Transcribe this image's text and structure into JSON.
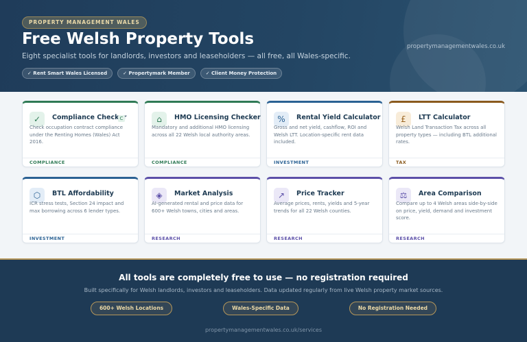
{
  "hero": {
    "kicker": "PROPERTY MANAGEMENT WALES",
    "title": "Free Welsh Property Tools",
    "subtitle": "Eight specialist tools for landlords, investors and leaseholders — all free, all Wales-specific.",
    "site": "propertymanagementwales.co.uk",
    "badges": [
      "✓ Rent Smart Wales Licensed",
      "✓ Propertymark Member",
      "✓ Client Money Protection"
    ]
  },
  "tools": [
    {
      "title": "Compliance Checker",
      "icon": "✓",
      "icon_name": "check-icon",
      "desc": "Check occupation contract compliance under the Renting Homes (Wales) Act 2016.",
      "category": "COMPLIANCE",
      "extra": "C"
    },
    {
      "title": "HMO Licensing Checker",
      "icon": "⌂",
      "icon_name": "house-icon",
      "desc": "Mandatory and additional HMO licensing across all 22 Welsh local authority areas.",
      "category": "COMPLIANCE"
    },
    {
      "title": "Rental Yield Calculator",
      "icon": "%",
      "icon_name": "percent-icon",
      "desc": "Gross and net yield, cashflow, ROI and Welsh LTT. Location-specific rent data included.",
      "category": "INVESTMENT"
    },
    {
      "title": "LTT Calculator",
      "icon": "£",
      "icon_name": "pound-icon",
      "desc": "Welsh Land Transaction Tax across all property types — including BTL additional rates.",
      "category": "TAX"
    },
    {
      "title": "BTL Affordability",
      "icon": "⬡",
      "icon_name": "hexagon-icon",
      "desc": "ICR stress tests, Section 24 impact and max borrowing across 6 lender types.",
      "category": "INVESTMENT"
    },
    {
      "title": "Market Analysis",
      "icon": "◈",
      "icon_name": "diamond-icon",
      "desc": "AI-generated rental and price data for 600+ Welsh towns, cities and areas.",
      "category": "RESEARCH"
    },
    {
      "title": "Price Tracker",
      "icon": "↗",
      "icon_name": "trend-up-icon",
      "desc": "Average prices, rents, yields and 5-year trends for all 22 Welsh counties.",
      "category": "RESEARCH"
    },
    {
      "title": "Area Comparison",
      "icon": "⚖",
      "icon_name": "scales-icon",
      "desc": "Compare up to 4 Welsh areas side-by-side on price, yield, demand and investment score.",
      "category": "RESEARCH"
    }
  ],
  "footer": {
    "title": "All tools are completely free to use — no registration required",
    "subtitle": "Built specifically for Welsh landlords, investors and leaseholders. Data updated regularly from live Welsh property market sources.",
    "pills": [
      "600+ Welsh Locations",
      "Wales-Specific Data",
      "No Registration Needed"
    ],
    "link": "propertymanagementwales.co.uk/services"
  },
  "colors": {
    "hero_bg": "#234563",
    "compliance": "#2f7a55",
    "investment": "#2a6193",
    "tax": "#8a5a1e",
    "research": "#5b4fa8",
    "gold_accent": "#b6975a"
  }
}
